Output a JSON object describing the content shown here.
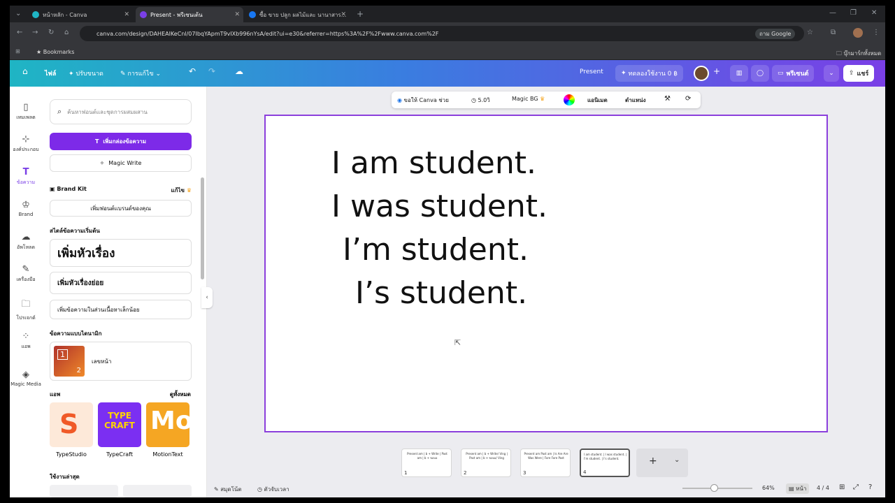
{
  "browser": {
    "tabs": [
      {
        "title": "หน้าหลัก - Canva",
        "favicon_color": "#1fb5c4"
      },
      {
        "title": "Present - พรีเซนเต้น",
        "favicon_color": "#7a3fe6"
      },
      {
        "title": "ซื้อ ขาย ปลูก ผลไม้และ นานาสาร...",
        "favicon_color": "#1877f2"
      }
    ],
    "url": "canva.com/design/DAHEAIKeCnl/07IbqYApmT9vIXb996nYsA/edit?ui=e30&referrer=https%3A%2F%2Fwww.canva.com%2F",
    "google_label": "ถาม Google",
    "bookmarks_label": "Bookmarks",
    "all_bookmarks_label": "บุ๊กมาร์กทั้งหมด"
  },
  "header": {
    "file": "ไฟล์",
    "resize": "ปรับขนาด",
    "edit": "การแก้ไข",
    "present": "Present",
    "trial": "ทดลองใช้งาน 0 ฿",
    "share_present": "พรีเซนต์",
    "share": "แชร์"
  },
  "rail": [
    {
      "label": "เทมเพลต",
      "icon": "template-icon"
    },
    {
      "label": "องค์ประกอบ",
      "icon": "elements-icon"
    },
    {
      "label": "ข้อความ",
      "icon": "text-icon"
    },
    {
      "label": "Brand",
      "icon": "brand-icon"
    },
    {
      "label": "อัพโหลด",
      "icon": "upload-icon"
    },
    {
      "label": "เครื่องมือ",
      "icon": "tools-icon"
    },
    {
      "label": "โปรเจกต์",
      "icon": "projects-icon"
    },
    {
      "label": "แอพ",
      "icon": "apps-icon"
    },
    {
      "label": "Magic Media",
      "icon": "magic-media-icon"
    }
  ],
  "panel": {
    "search_placeholder": "ค้นหาฟอนต์และชุดการผสมผสาน",
    "add_textbox": "เพิ่มกล่องข้อความ",
    "magic_write": "Magic Write",
    "brand_kit": "Brand Kit",
    "brand_edit": "แก้ไข",
    "add_brand_font": "เพิ่มฟอนต์แบรนด์ของคุณ",
    "default_styles_title": "สไตล์ข้อความเริ่มต้น",
    "add_heading": "เพิ่มหัวเรื่อง",
    "add_subheading": "เพิ่มหัวเรื่องย่อย",
    "add_body": "เพิ่มข้อความในส่วนเนื้อหาเล็กน้อย",
    "dynamic_title": "ข้อความแบบไดนามิก",
    "page_numbers": "เลขหน้า",
    "apps_title": "แอพ",
    "see_all": "ดูทั้งหมด",
    "apps": [
      {
        "name": "TypeStudio",
        "color": "#f05a28"
      },
      {
        "name": "TypeCraft",
        "color": "#7b2ff2"
      },
      {
        "name": "MotionText",
        "color": "#f5a623"
      }
    ],
    "recent_title": "ใช้งานล่าสุด"
  },
  "context_toolbar": {
    "ask_canva": "ขอให้ Canva ช่วย",
    "duration": "5.0วิ",
    "magic_bg": "Magic BG",
    "animate": "แอนิเมต",
    "position": "ตำแหน่ง"
  },
  "slide": {
    "lines": [
      "I am student.",
      "I was student.",
      "I’m student.",
      "I’s student."
    ]
  },
  "thumbnails": [
    {
      "num": "1",
      "text": "Present am | b + Write | Past am | b + ขอบอ"
    },
    {
      "num": "2",
      "text": "Present am | b + Write/ Ving | Past am | b + ขอบอ/ Ving"
    },
    {
      "num": "3",
      "text": "Present am   Past am | Is Are Are   Was Were | Fore Fore   Past"
    },
    {
      "num": "4",
      "text": "I am student. | I was student. | I’m student. | I’s student."
    }
  ],
  "footer": {
    "notes": "สมุดโน้ต",
    "timer": "ตัวจับเวลา",
    "zoom": "64%",
    "pages_label": "หน้า",
    "page_count": "4 / 4"
  },
  "colors": {
    "accent": "#8b3fdc",
    "teal": "#1fb5c4"
  }
}
